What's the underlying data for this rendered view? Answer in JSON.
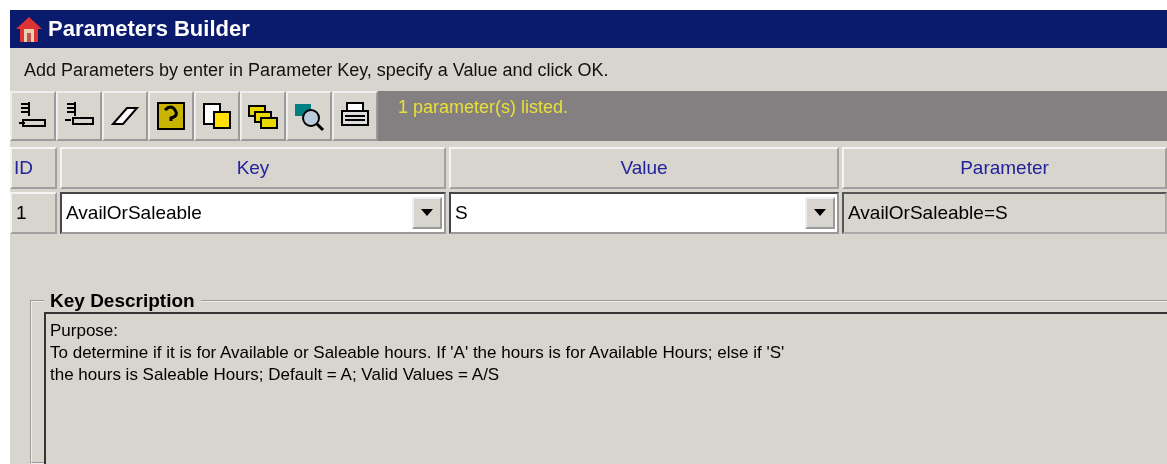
{
  "window": {
    "title": "Parameters Builder"
  },
  "instruction": "Add Parameters by enter in Parameter Key, specify a Value and click OK.",
  "toolbar": {
    "status": "1 parameter(s) listed."
  },
  "table": {
    "columns": [
      "ID",
      "Key",
      "Value",
      "Parameter"
    ],
    "rows": [
      {
        "id": "1",
        "key": "AvailOrSaleable",
        "value": "S",
        "parameter": "AvailOrSaleable=S"
      }
    ]
  },
  "key_description": {
    "title": "Key Description",
    "lines": [
      "Purpose:",
      "To determine if it is for Available or Saleable hours. If 'A' the hours is for Available Hours; else if 'S'",
      "the hours is Saleable Hours; Default = A; Valid Values = A/S"
    ]
  }
}
